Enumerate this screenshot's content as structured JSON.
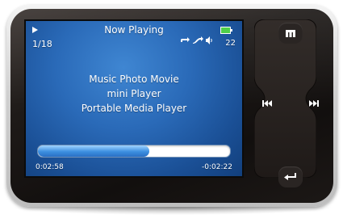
{
  "screen": {
    "title": "Now Playing",
    "track_counter": "1/18",
    "volume": "22",
    "lines": [
      "Music Photo Movie",
      "mini Player",
      "Portable Media Player"
    ],
    "elapsed": "0:02:58",
    "remaining": "-0:02:22",
    "progress_fraction": 0.58,
    "colors": {
      "screen_bg": "#2a6ab8",
      "progress_fill": "#3c8fe0",
      "battery": "#4fd04a"
    }
  },
  "icons": {
    "play": "play-icon",
    "battery": "battery-icon",
    "repeat": "repeat-icon",
    "shuffle": "shuffle-icon",
    "speaker": "speaker-icon",
    "menu": "menu-icon",
    "prev": "previous-icon",
    "next": "next-icon",
    "back": "back-icon"
  }
}
